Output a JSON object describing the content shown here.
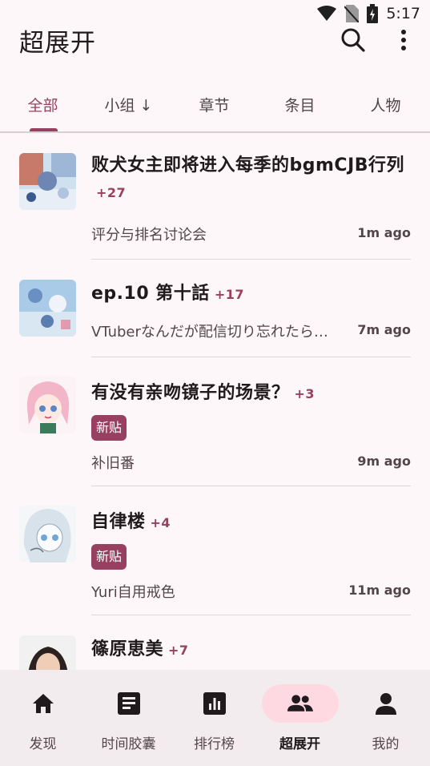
{
  "status": {
    "time": "5:17"
  },
  "appbar": {
    "title": "超展开",
    "search_icon": "search-icon",
    "more_icon": "more-vert-icon"
  },
  "tabs": [
    {
      "label": "全部",
      "active": true
    },
    {
      "label": "小组 ↓",
      "active": false
    },
    {
      "label": "章节",
      "active": false
    },
    {
      "label": "条目",
      "active": false
    },
    {
      "label": "人物",
      "active": false
    }
  ],
  "topics": [
    {
      "title": "败犬女主即将进入每季的bgmCJB行列",
      "count": "+27",
      "badge": "",
      "subtitle": "评分与排名讨论会",
      "time": "1m ago"
    },
    {
      "title": "ep.10 第十話",
      "count": "+17",
      "badge": "",
      "subtitle": "VTuberなんだが配信切り忘れたら伝説になってた",
      "time": "7m ago"
    },
    {
      "title": "有没有亲吻镜子的场景？",
      "count": "+3",
      "badge": "新贴",
      "subtitle": "补旧番",
      "time": "9m ago"
    },
    {
      "title": "自律楼",
      "count": "+4",
      "badge": "新贴",
      "subtitle": "Yuri自用戒色",
      "time": "11m ago"
    },
    {
      "title": "篠原恵美",
      "count": "+7",
      "badge": "",
      "subtitle": "",
      "time": ""
    }
  ],
  "nav": [
    {
      "label": "发现",
      "icon": "home-icon",
      "active": false
    },
    {
      "label": "时间胶囊",
      "icon": "timeline-icon",
      "active": false
    },
    {
      "label": "排行榜",
      "icon": "ranking-icon",
      "active": false
    },
    {
      "label": "超展开",
      "icon": "group-icon",
      "active": true
    },
    {
      "label": "我的",
      "icon": "person-icon",
      "active": false
    }
  ],
  "colors": {
    "accent": "#98405f",
    "pill": "#ffd9e2",
    "background": "#fdf7fa",
    "nav_background": "#f3ecef"
  }
}
